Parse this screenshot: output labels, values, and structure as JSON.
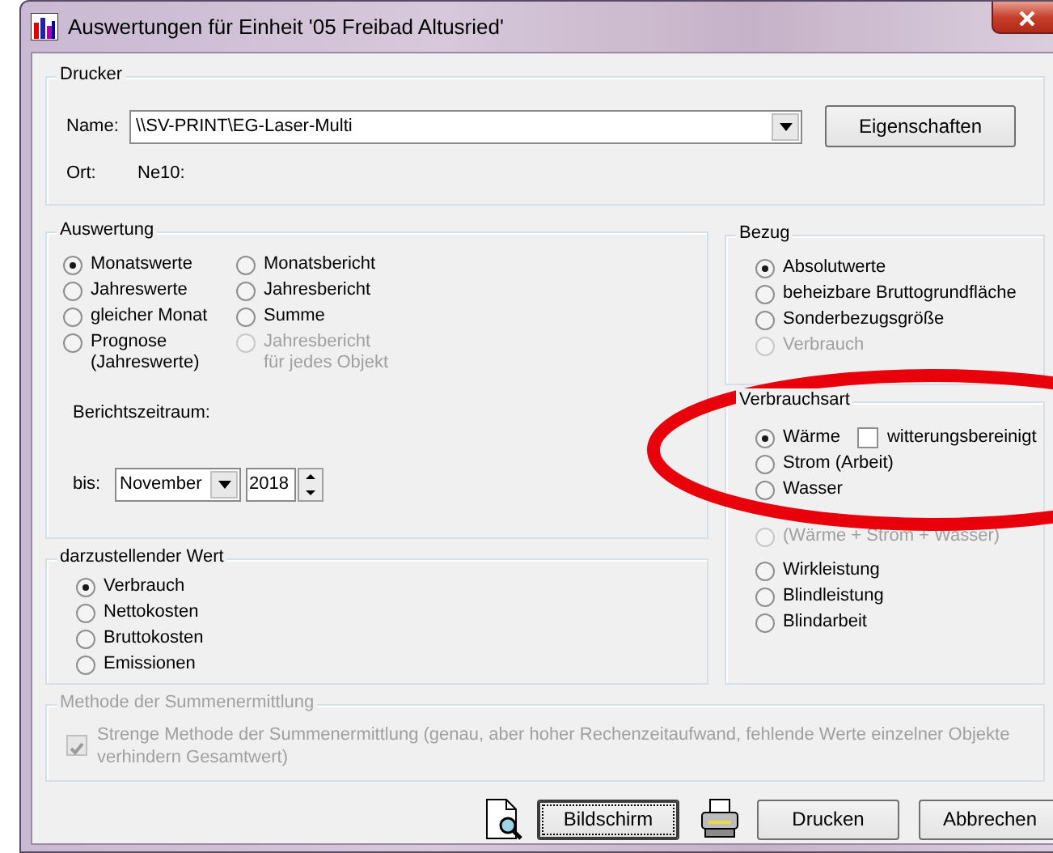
{
  "window": {
    "title": "Auswertungen für Einheit '05 Freibad Altusried'"
  },
  "printer": {
    "title": "Drucker",
    "name_label": "Name:",
    "name_value": "\\\\SV-PRINT\\EG-Laser-Multi",
    "properties_button": "Eigenschaften",
    "location_label": "Ort:",
    "location_value": "Ne10:"
  },
  "evaluation": {
    "title": "Auswertung",
    "options": [
      {
        "label": "Monatswerte",
        "selected": true,
        "disabled": false
      },
      {
        "label": "Monatsbericht",
        "selected": false,
        "disabled": false
      },
      {
        "label": "Jahreswerte",
        "selected": false,
        "disabled": false
      },
      {
        "label": "Jahresbericht",
        "selected": false,
        "disabled": false
      },
      {
        "label": "gleicher Monat",
        "selected": false,
        "disabled": false
      },
      {
        "label": "Summe",
        "selected": false,
        "disabled": false
      },
      {
        "label": "Prognose\n(Jahreswerte)",
        "selected": false,
        "disabled": false
      },
      {
        "label": "Jahresbericht\nfür jedes Objekt",
        "selected": false,
        "disabled": true
      }
    ],
    "period_label": "Berichtszeitraum:",
    "until_label": "bis:",
    "month": "November",
    "year": "2018"
  },
  "reference": {
    "title": "Bezug",
    "options": [
      {
        "label": "Absolutwerte",
        "selected": true,
        "disabled": false
      },
      {
        "label": "beheizbare Bruttogrundfläche",
        "selected": false,
        "disabled": false
      },
      {
        "label": "Sonderbezugsgröße",
        "selected": false,
        "disabled": false
      },
      {
        "label": "Verbrauch",
        "selected": false,
        "disabled": true
      }
    ]
  },
  "consumption_type": {
    "title": "Verbrauchsart",
    "options": [
      {
        "label": "Wärme",
        "selected": true,
        "disabled": false,
        "checkbox": {
          "label": "witterungsbereinigt",
          "checked": false
        }
      },
      {
        "label": "Strom (Arbeit)",
        "selected": false,
        "disabled": false
      },
      {
        "label": "Wasser",
        "selected": false,
        "disabled": false
      },
      {
        "label": "(Wärme + Strom + Wasser)",
        "selected": false,
        "disabled": true
      },
      {
        "label": "Wirkleistung",
        "selected": false,
        "disabled": false
      },
      {
        "label": "Blindleistung",
        "selected": false,
        "disabled": false
      },
      {
        "label": "Blindarbeit",
        "selected": false,
        "disabled": false
      }
    ]
  },
  "value": {
    "title": "darzustellender Wert",
    "options": [
      {
        "label": "Verbrauch",
        "selected": true,
        "disabled": false
      },
      {
        "label": "Nettokosten",
        "selected": false,
        "disabled": false
      },
      {
        "label": "Bruttokosten",
        "selected": false,
        "disabled": false
      },
      {
        "label": "Emissionen",
        "selected": false,
        "disabled": false
      }
    ]
  },
  "method": {
    "title": "Methode der Summenermittlung",
    "disabled": true,
    "checkbox": {
      "label": "Strenge Methode der Summenermittlung (genau, aber hoher Rechenzeitaufwand, fehlende Werte einzelner Objekte\nverhindern Gesamtwert)",
      "checked": true
    }
  },
  "buttons": [
    {
      "kind": "preview",
      "label": "Bildschirm",
      "focused": true
    },
    {
      "kind": "print",
      "label": "Drucken",
      "focused": false
    },
    {
      "kind": "plain",
      "label": "Abbrechen",
      "focused": false
    }
  ],
  "annotations": [
    {
      "kind": "ellipse",
      "color": "#e8000b"
    }
  ]
}
